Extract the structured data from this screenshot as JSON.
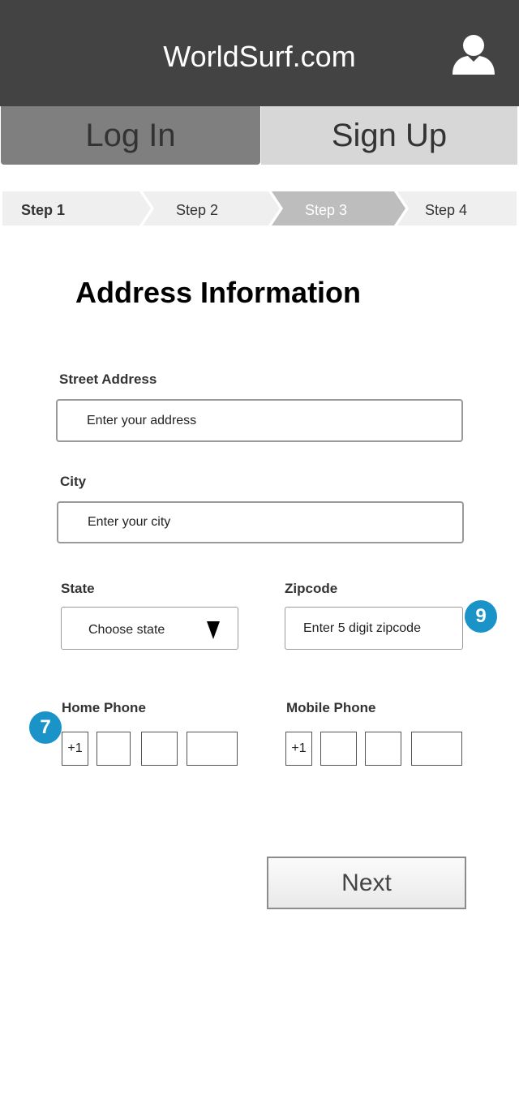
{
  "header": {
    "title": "WorldSurf.com",
    "user_icon": "user-avatar-icon"
  },
  "auth_tabs": {
    "login": "Log In",
    "signup": "Sign Up"
  },
  "steps": [
    {
      "label": "Step 1",
      "state": "active"
    },
    {
      "label": "Step 2",
      "state": "inactive"
    },
    {
      "label": "Step 3",
      "state": "current"
    },
    {
      "label": "Step 4",
      "state": "inactive"
    }
  ],
  "form": {
    "title": "Address Information",
    "street": {
      "label": "Street Address",
      "placeholder": "Enter your address",
      "value": ""
    },
    "city": {
      "label": "City",
      "placeholder": "Enter your city",
      "value": ""
    },
    "state": {
      "label": "State",
      "selected": "Choose state"
    },
    "zipcode": {
      "label": "Zipcode",
      "placeholder": "Enter 5 digit zipcode",
      "value": ""
    },
    "home_phone": {
      "label": "Home Phone",
      "country_code": "+1"
    },
    "mobile_phone": {
      "label": "Mobile Phone",
      "country_code": "+1"
    }
  },
  "annotations": {
    "zipcode_badge": "9",
    "home_phone_badge": "7"
  },
  "actions": {
    "next": "Next"
  },
  "colors": {
    "header_bg": "#434343",
    "login_tab_bg": "#7f7f7f",
    "signup_tab_bg": "#d7d7d7",
    "step_bg": "#efefef",
    "step_current_bg": "#bdbdbd",
    "badge": "#1a93c9"
  }
}
